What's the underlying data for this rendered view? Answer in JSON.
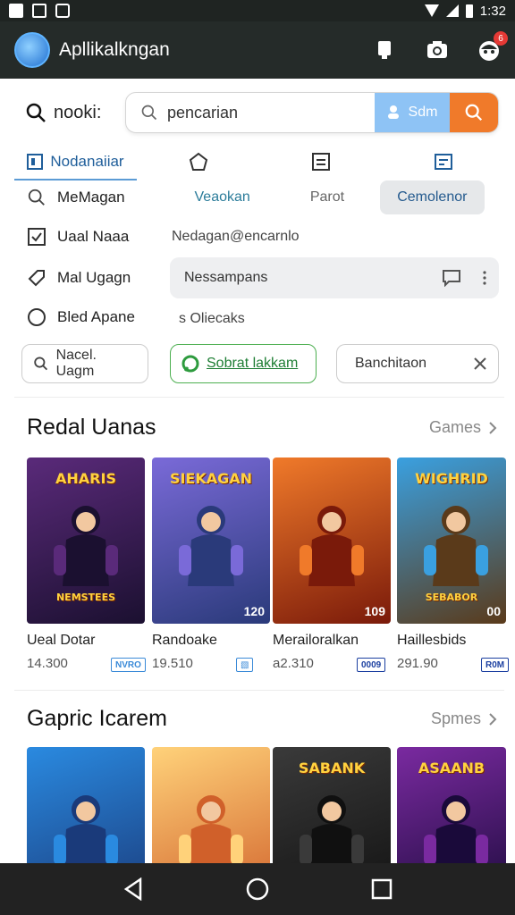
{
  "status": {
    "time": "1:32"
  },
  "app": {
    "title": "Apllikalkngan"
  },
  "search": {
    "label": "nooki:",
    "value": "pencarian",
    "send_label": "Sdm"
  },
  "tabs": [
    {
      "label": "Nodanaiiar"
    }
  ],
  "filters": {
    "row1": {
      "label": "MeMagan",
      "seg1": "Veaokan",
      "seg2": "Parot",
      "seg3": "Cemolenor"
    },
    "row2": {
      "label": "Uaal Naaa",
      "text": "Nedagan@encarnlo"
    },
    "row3": {
      "label": "Mal Ugagn",
      "text": "Nessampans"
    },
    "row4": {
      "label": "Bled Apane",
      "text": "s Oliecaks"
    }
  },
  "chips": [
    {
      "label": "Nacel. Uagm"
    },
    {
      "label": "Sobrat lakkam"
    },
    {
      "label": "Banchitaon"
    }
  ],
  "section1": {
    "title": "Redal Uanas",
    "link": "Games",
    "cards": [
      {
        "art_title": "AHARIS",
        "art_sub": "NEMSTEES",
        "corner": "",
        "name": "Ueal Dotar",
        "price": "14.300",
        "tag": "NVRO",
        "tag_color": "#3a8ad8",
        "bg1": "#5a2a7a",
        "bg2": "#1b1030"
      },
      {
        "art_title": "SIEKAGAN",
        "art_sub": "",
        "corner": "120",
        "name": "Randoake",
        "price": "19.510",
        "tag": "▧",
        "tag_color": "#3a8ad8",
        "bg1": "#7a6ad8",
        "bg2": "#2a3a7a"
      },
      {
        "art_title": "",
        "art_sub": "",
        "corner": "109",
        "name": "Merailoralkan",
        "price": "а2.310",
        "tag": "0009",
        "tag_color": "#1b3fa0",
        "bg1": "#f07a2a",
        "bg2": "#7a1a0a"
      },
      {
        "art_title": "WIGHRID",
        "art_sub": "SEBABOR",
        "corner": "00",
        "name": "Haillesbids",
        "price": "291.90",
        "tag": "R0M",
        "tag_color": "#1b3fa0",
        "bg1": "#3aa0e0",
        "bg2": "#5a3a1a"
      }
    ]
  },
  "section2": {
    "title": "Gapric Icarem",
    "link": "Spmes",
    "cards": [
      {
        "art_title": "",
        "bg1": "#2a8ae0",
        "bg2": "#1a3a7a"
      },
      {
        "art_title": "",
        "bg1": "#ffd27a",
        "bg2": "#d0602a"
      },
      {
        "art_title": "SABANK",
        "bg1": "#3a3a3a",
        "bg2": "#101010"
      },
      {
        "art_title": "ASAANB",
        "bg1": "#7a2aa0",
        "bg2": "#1a0a3a"
      }
    ]
  },
  "colors": {
    "appbar": "#252b29",
    "accent_blue": "#8ec3f5",
    "accent_orange": "#f07a2a"
  }
}
